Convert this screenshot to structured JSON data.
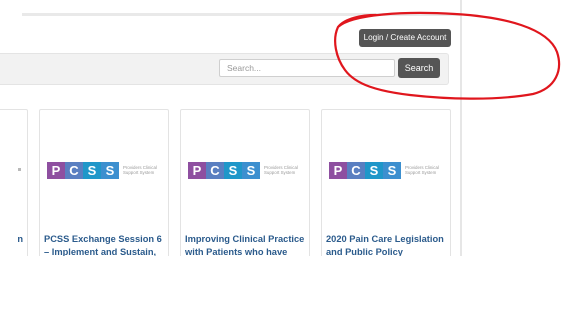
{
  "header": {
    "login_label": "Login / Create Account"
  },
  "search": {
    "placeholder": "Search...",
    "button_label": "Search"
  },
  "brand": {
    "letters": [
      "P",
      "C",
      "S",
      "S"
    ],
    "tile_colors": [
      "#8e4fa0",
      "#5a7fc1",
      "#1f97c9",
      "#3c8fcf"
    ],
    "tagline": "Providers Clinical Support System"
  },
  "cards": {
    "partial_title": "n",
    "items": [
      {
        "title": "PCSS Exchange Session 6 – Implement and Sustain,"
      },
      {
        "title": "Improving Clinical Practice with Patients who have"
      },
      {
        "title": "2020 Pain Care Legislation and Public Policy"
      }
    ]
  },
  "annotation": {
    "color": "#e0161d"
  }
}
